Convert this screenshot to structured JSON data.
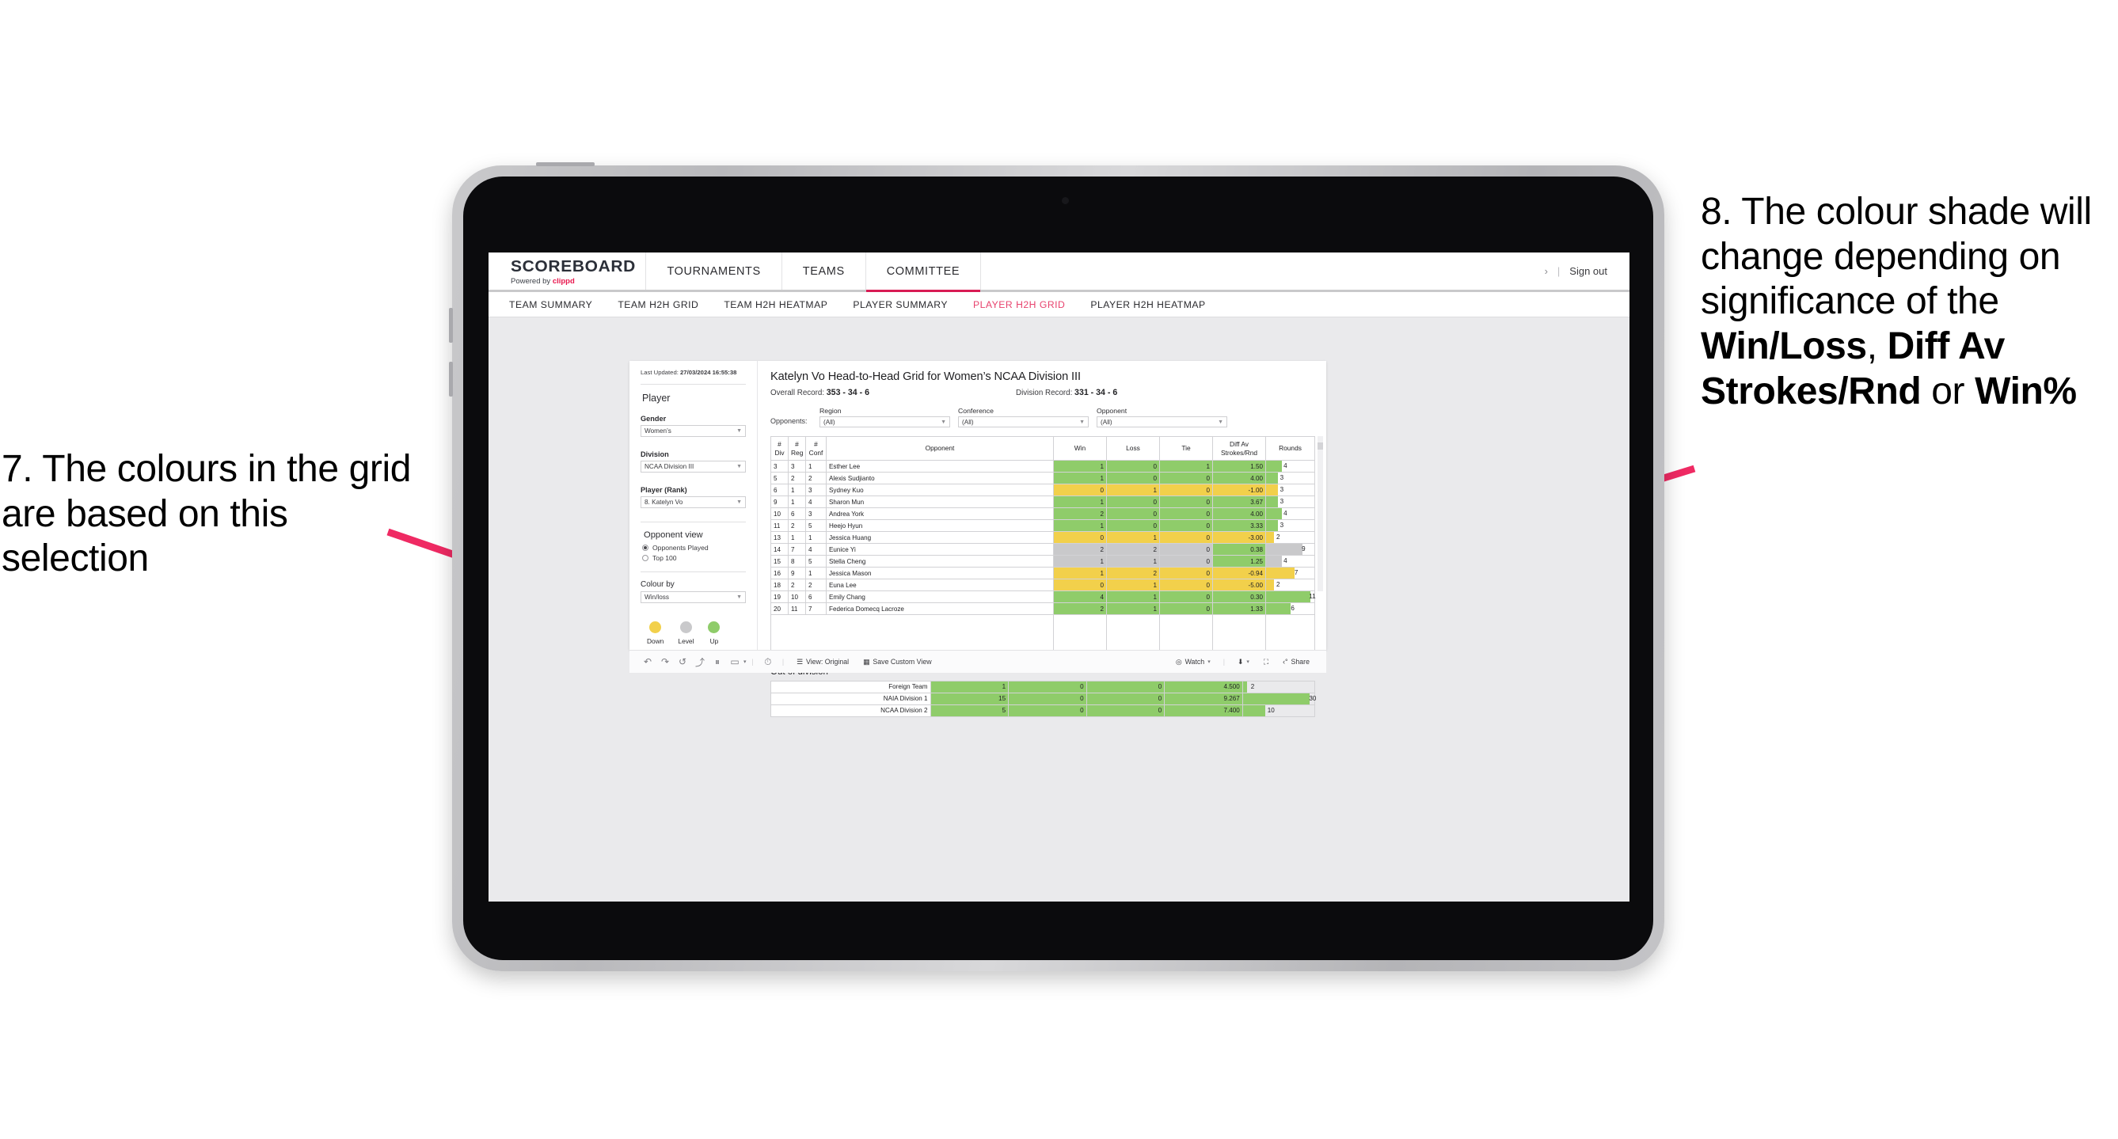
{
  "annotations": {
    "left": "7. The colours in the grid are based on this selection",
    "right_parts": [
      {
        "text": "8. The colour shade will change depending on significance of the ",
        "bold": false
      },
      {
        "text": "Win/Loss",
        "bold": true
      },
      {
        "text": ", ",
        "bold": false
      },
      {
        "text": "Diff Av Strokes/Rnd",
        "bold": true
      },
      {
        "text": " or ",
        "bold": false
      },
      {
        "text": "Win%",
        "bold": true
      }
    ],
    "arrow_color": "#ef2a63"
  },
  "app": {
    "brand": {
      "title": "SCOREBOARD",
      "powered_prefix": "Powered by ",
      "powered_name": "clippd"
    },
    "topnav": [
      {
        "label": "TOURNAMENTS",
        "active": false
      },
      {
        "label": "TEAMS",
        "active": false
      },
      {
        "label": "COMMITTEE",
        "active": true
      }
    ],
    "topright": {
      "chevron": "›",
      "separator": "|",
      "signout": "Sign out"
    },
    "subnav": [
      {
        "label": "TEAM SUMMARY",
        "active": false
      },
      {
        "label": "TEAM H2H GRID",
        "active": false
      },
      {
        "label": "TEAM H2H HEATMAP",
        "active": false
      },
      {
        "label": "PLAYER SUMMARY",
        "active": false
      },
      {
        "label": "PLAYER H2H GRID",
        "active": true
      },
      {
        "label": "PLAYER H2H HEATMAP",
        "active": false
      }
    ],
    "accent": "#e8436e",
    "brand_red": "#e8174d"
  },
  "filters": {
    "last_updated_label": "Last Updated: ",
    "last_updated_value": "27/03/2024 16:55:38",
    "heading": "Player",
    "gender": {
      "label": "Gender",
      "value": "Women’s"
    },
    "division": {
      "label": "Division",
      "value": "NCAA Division III"
    },
    "player_rank": {
      "label": "Player (Rank)",
      "value": "8. Katelyn Vo"
    },
    "opponent_view": {
      "heading": "Opponent view",
      "options": [
        {
          "label": "Opponents Played",
          "selected": true
        },
        {
          "label": "Top 100",
          "selected": false
        }
      ]
    },
    "colour_by": {
      "label": "Colour by",
      "value": "Win/loss"
    },
    "legend": [
      {
        "label": "Down",
        "color": "#f2d04b"
      },
      {
        "label": "Level",
        "color": "#c9c9cb"
      },
      {
        "label": "Up",
        "color": "#8fcc6a"
      }
    ]
  },
  "main": {
    "title": "Katelyn Vo Head-to-Head Grid for Women’s NCAA Division III",
    "overall_record_label": "Overall Record: ",
    "overall_record_value": "353 -  34 - 6",
    "division_record_label": "Division Record: ",
    "division_record_value": "331 -  34 - 6",
    "opponents_label": "Opponents:",
    "opponent_filters": [
      {
        "label": "Region",
        "value": "(All)"
      },
      {
        "label": "Conference",
        "value": "(All)"
      },
      {
        "label": "Opponent",
        "value": "(All)"
      }
    ]
  },
  "chart_data": {
    "type": "table",
    "title": "Katelyn Vo Head-to-Head Grid for Women’s NCAA Division III",
    "columns": [
      "# Div",
      "# Reg",
      "# Conf",
      "Opponent",
      "Win",
      "Loss",
      "Tie",
      "Diff Av Strokes/Rnd",
      "Rounds"
    ],
    "header_lines": [
      [
        "#",
        "Div"
      ],
      [
        "#",
        "Reg"
      ],
      [
        "#",
        "Conf"
      ],
      [
        "Opponent",
        ""
      ],
      [
        "Win",
        ""
      ],
      [
        "Loss",
        ""
      ],
      [
        "Tie",
        ""
      ],
      [
        "Diff Av",
        "Strokes/Rnd"
      ],
      [
        "Rounds",
        ""
      ]
    ],
    "rounds_max": 12,
    "rows": [
      {
        "div": "3",
        "reg": "3",
        "conf": "1",
        "opponent": "Esther Lee",
        "win": "1",
        "loss": "0",
        "tie": "1",
        "diff": "1.50",
        "rounds": "4",
        "shade": "green"
      },
      {
        "div": "5",
        "reg": "2",
        "conf": "2",
        "opponent": "Alexis Sudjianto",
        "win": "1",
        "loss": "0",
        "tie": "0",
        "diff": "4.00",
        "rounds": "3",
        "shade": "green"
      },
      {
        "div": "6",
        "reg": "1",
        "conf": "3",
        "opponent": "Sydney Kuo",
        "win": "0",
        "loss": "1",
        "tie": "0",
        "diff": "-1.00",
        "rounds": "3",
        "shade": "yellow"
      },
      {
        "div": "9",
        "reg": "1",
        "conf": "4",
        "opponent": "Sharon Mun",
        "win": "1",
        "loss": "0",
        "tie": "0",
        "diff": "3.67",
        "rounds": "3",
        "shade": "green"
      },
      {
        "div": "10",
        "reg": "6",
        "conf": "3",
        "opponent": "Andrea York",
        "win": "2",
        "loss": "0",
        "tie": "0",
        "diff": "4.00",
        "rounds": "4",
        "shade": "green"
      },
      {
        "div": "11",
        "reg": "2",
        "conf": "5",
        "opponent": "Heejo Hyun",
        "win": "1",
        "loss": "0",
        "tie": "0",
        "diff": "3.33",
        "rounds": "3",
        "shade": "green"
      },
      {
        "div": "13",
        "reg": "1",
        "conf": "1",
        "opponent": "Jessica Huang",
        "win": "0",
        "loss": "1",
        "tie": "0",
        "diff": "-3.00",
        "rounds": "2",
        "shade": "yellow"
      },
      {
        "div": "14",
        "reg": "7",
        "conf": "4",
        "opponent": "Eunice Yi",
        "win": "2",
        "loss": "2",
        "tie": "0",
        "diff": "0.38",
        "rounds": "9",
        "shade": "grey",
        "diff_shade": "green"
      },
      {
        "div": "15",
        "reg": "8",
        "conf": "5",
        "opponent": "Stella Cheng",
        "win": "1",
        "loss": "1",
        "tie": "0",
        "diff": "1.25",
        "rounds": "4",
        "shade": "grey",
        "diff_shade": "green"
      },
      {
        "div": "16",
        "reg": "9",
        "conf": "1",
        "opponent": "Jessica Mason",
        "win": "1",
        "loss": "2",
        "tie": "0",
        "diff": "-0.94",
        "rounds": "7",
        "shade": "yellow"
      },
      {
        "div": "18",
        "reg": "2",
        "conf": "2",
        "opponent": "Euna Lee",
        "win": "0",
        "loss": "1",
        "tie": "0",
        "diff": "-5.00",
        "rounds": "2",
        "shade": "yellow"
      },
      {
        "div": "19",
        "reg": "10",
        "conf": "6",
        "opponent": "Emily Chang",
        "win": "4",
        "loss": "1",
        "tie": "0",
        "diff": "0.30",
        "rounds": "11",
        "shade": "green"
      },
      {
        "div": "20",
        "reg": "11",
        "conf": "7",
        "opponent": "Federica Domecq Lacroze",
        "win": "2",
        "loss": "1",
        "tie": "0",
        "diff": "1.33",
        "rounds": "6",
        "shade": "green"
      }
    ],
    "out_of_division": {
      "title": "Out of division",
      "rounds_max": 32,
      "rows": [
        {
          "name": "Foreign Team",
          "win": "1",
          "loss": "0",
          "tie": "0",
          "diff": "4.500",
          "rounds": "2",
          "shade": "green"
        },
        {
          "name": "NAIA Division 1",
          "win": "15",
          "loss": "0",
          "tie": "0",
          "diff": "9.267",
          "rounds": "30",
          "shade": "green"
        },
        {
          "name": "NCAA Division 2",
          "win": "5",
          "loss": "0",
          "tie": "0",
          "diff": "7.400",
          "rounds": "10",
          "shade": "green"
        }
      ]
    }
  },
  "toolbar": {
    "icons": [
      "undo-icon",
      "redo-icon",
      "revert-icon",
      "refresh-data-icon",
      "pause-updates-icon",
      "highlight-icon"
    ],
    "glyphs": [
      "↶",
      "↷",
      "↺",
      "⤴",
      "⏸",
      "▭"
    ],
    "caret": "▾",
    "separator": "|",
    "view_label": "View: Original",
    "save_label": "Save Custom View",
    "watch_label": "Watch",
    "share_label": "Share",
    "view_icon": "☰",
    "save_icon": "▦",
    "watch_icon": "◎",
    "download_icon": "⬇",
    "fullscreen_icon": "⛶",
    "share_icon": "‹°"
  }
}
